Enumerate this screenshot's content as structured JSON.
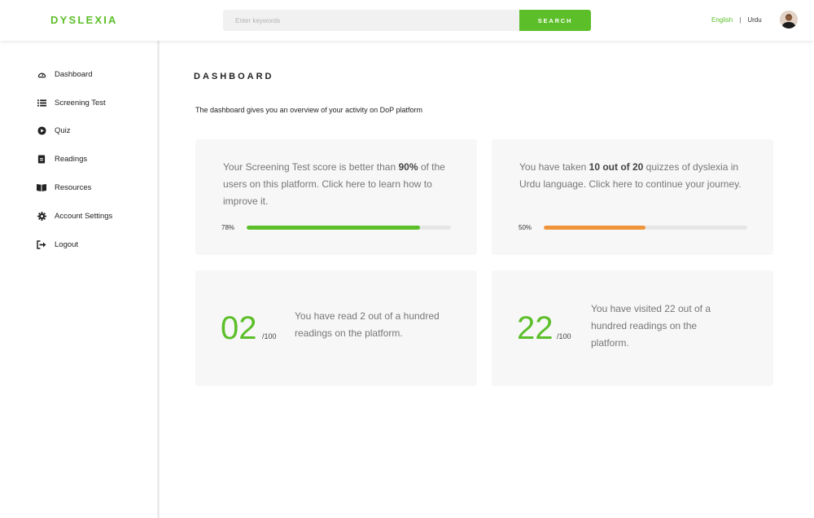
{
  "header": {
    "logo": "DYSLEXIA",
    "search_placeholder": "Enter keywords",
    "search_button": "SEARCH",
    "lang_active": "English",
    "lang_separator": "|",
    "lang_other": "Urdu"
  },
  "sidebar": {
    "items": [
      {
        "label": "Dashboard",
        "icon": "dashboard-icon"
      },
      {
        "label": "Screening Test",
        "icon": "list-icon"
      },
      {
        "label": "Quiz",
        "icon": "play-icon"
      },
      {
        "label": "Readings",
        "icon": "reading-icon"
      },
      {
        "label": "Resources",
        "icon": "book-icon"
      },
      {
        "label": "Account Settings",
        "icon": "gear-icon"
      },
      {
        "label": "Logout",
        "icon": "logout-icon"
      }
    ]
  },
  "main": {
    "title": "DASHBOARD",
    "description": "The dashboard gives you an overview of your activity on DoP platform",
    "cards": {
      "screening": {
        "text_pre": "Your Screening Test score is better than ",
        "text_bold": "90%",
        "text_post": " of the users on this platform. Click here to learn how to improve it.",
        "progress_label": "78%",
        "progress_value": 0.85
      },
      "quizzes": {
        "text_pre": "You have taken ",
        "text_bold": "10 out of 20",
        "text_post": " quizzes of dyslexia in Urdu language. Click here to continue your journey.",
        "progress_label": "50%",
        "progress_value": 0.5
      },
      "readings": {
        "number": "02",
        "denominator": "/100",
        "text": "You have read 2 out of a hundred readings on the platform."
      },
      "visited": {
        "number": "22",
        "denominator": "/100",
        "text": "You have visited 22 out of a hundred readings on the platform."
      }
    }
  },
  "colors": {
    "accent": "#5cbf2a",
    "orange": "#f0943a",
    "card_bg": "#f7f7f7"
  }
}
